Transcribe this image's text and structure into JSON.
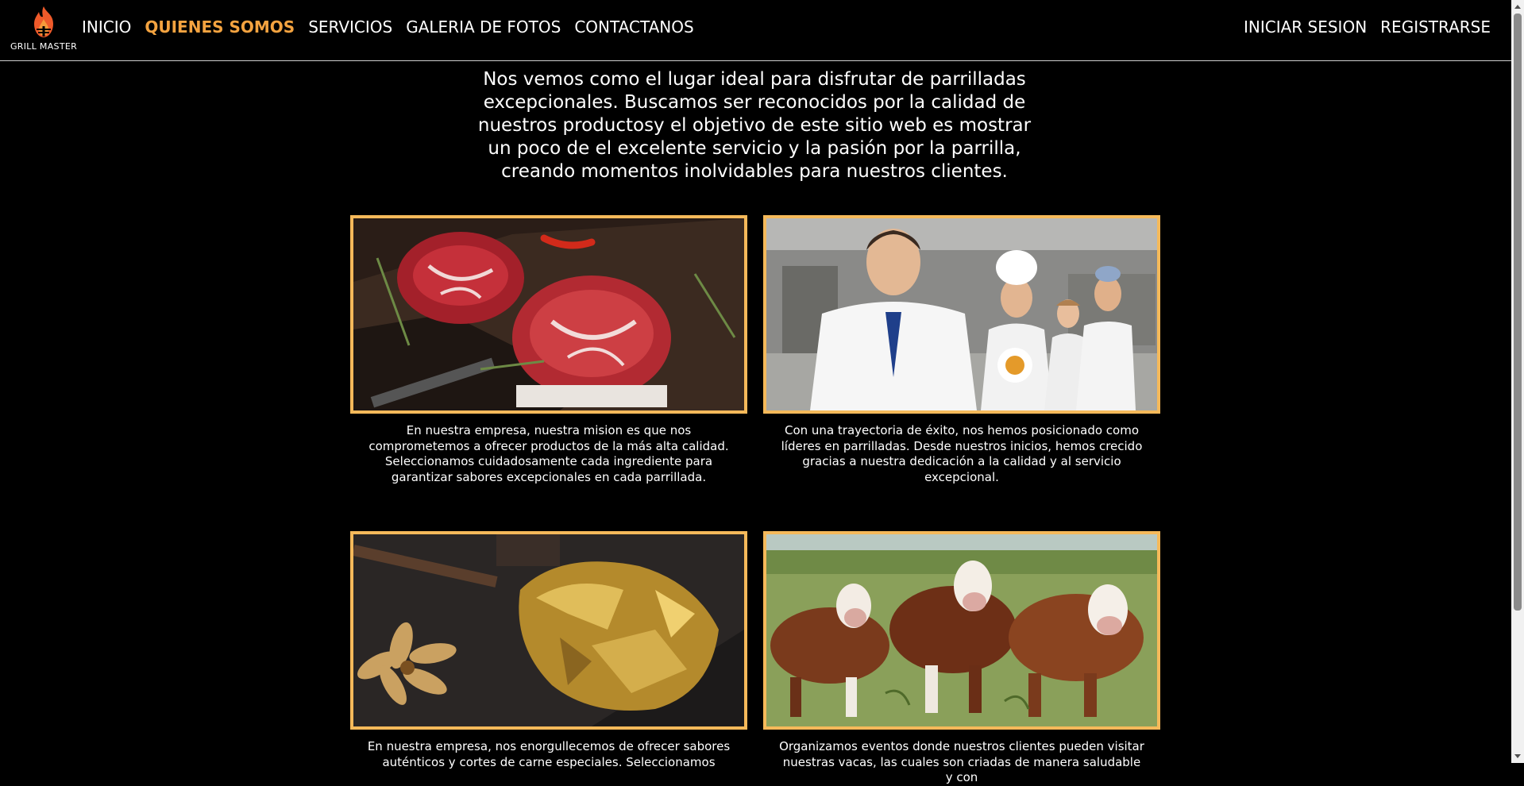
{
  "header": {
    "logo_text": "GRILL MASTER",
    "nav_left": [
      {
        "label": "INICIO",
        "active": false
      },
      {
        "label": "QUIENES SOMOS",
        "active": true
      },
      {
        "label": "SERVICIOS",
        "active": false
      },
      {
        "label": "GALERIA DE FOTOS",
        "active": false
      },
      {
        "label": "CONTACTANOS",
        "active": false
      }
    ],
    "nav_right": [
      {
        "label": "INICIAR SESION"
      },
      {
        "label": "REGISTRARSE"
      }
    ]
  },
  "intro": {
    "text": "Nos vemos como el lugar ideal para disfrutar de parrilladas excepcionales. Buscamos ser reconocidos por la calidad de nuestros productosy el objetivo de este sitio web es mostrar un poco de el excelente servicio y la pasión por la parrilla, creando momentos inolvidables para nuestros clientes."
  },
  "cards": [
    {
      "image": "raw-steaks-photo",
      "text": "En nuestra empresa, nuestra mision es que nos comprometemos a ofrecer productos de la más alta calidad. Seleccionamos cuidadosamente cada ingrediente para garantizar sabores excepcionales en cada parrillada."
    },
    {
      "image": "chef-team-photo",
      "text": "Con una trayectoria de éxito, nos hemos posicionado como líderes en parrilladas. Desde nuestros inicios, hemos crecido gracias a nuestra dedicación a la calidad y al servicio excepcional."
    },
    {
      "image": "gold-wrapped-steak-photo",
      "text": "En nuestra empresa, nos enorgullecemos de ofrecer sabores auténticos y cortes de carne especiales. Seleccionamos"
    },
    {
      "image": "cattle-in-field-photo",
      "text": "Organizamos eventos donde nuestros clientes pueden visitar nuestras vacas, las cuales son criadas de manera saludable y con"
    }
  ],
  "colors": {
    "accent": "#f4a340",
    "frame_border": "#f5b95a",
    "background": "#000000"
  }
}
